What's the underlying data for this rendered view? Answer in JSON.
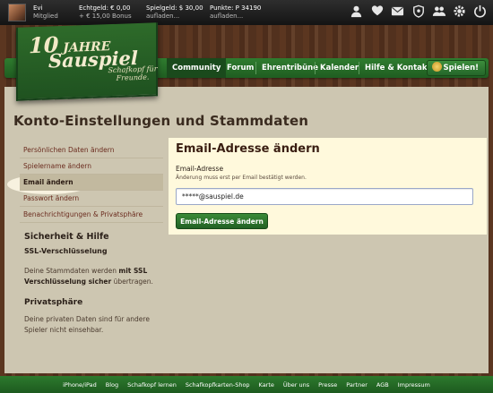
{
  "topbar": {
    "user_name": "Evi",
    "user_status": "Mitglied",
    "echtgeld": "Echtgeld: € 0,00",
    "bonus": "+ € 15,00 Bonus",
    "spielgeld": "Spielgeld: $ 30,00",
    "spielgeld_sub": "aufladen...",
    "punkte": "Punkte: P 34190",
    "punkte_sub": "aufladen...",
    "icons": [
      "profile-icon",
      "heart-icon",
      "mail-icon",
      "shield-icon",
      "friends-icon",
      "settings-icon",
      "logout-icon"
    ]
  },
  "logo": {
    "jahre_number": "10",
    "jahre_text": "JAHRE",
    "name": "Sauspiel",
    "tagline": "Schafkopf für Freunde."
  },
  "nav": {
    "items": [
      "Community",
      "Forum",
      "Ehrentribüne",
      "Kalender",
      "Hilfe & Kontakt"
    ],
    "active": "Community",
    "play_label": "Spielen!"
  },
  "page": {
    "title": "Konto-Einstellungen und Stammdaten"
  },
  "sidebar": {
    "items": [
      "Persönlichen Daten ändern",
      "Spielername ändern",
      "Email ändern",
      "Passwort ändern",
      "Benachrichtigungen & Privatsphäre"
    ],
    "active": "Email ändern",
    "security_heading": "Sicherheit & Hilfe",
    "ssl_heading": "SSL-Verschlüsselung",
    "ssl_text_1": "Deine Stammdaten werden ",
    "ssl_text_bold": "mit SSL Verschlüsselung sicher",
    "ssl_text_2": " übertragen.",
    "privacy_heading": "Privatsphäre",
    "privacy_text": "Deine privaten Daten sind für andere Spieler nicht einsehbar."
  },
  "form": {
    "title": "Email-Adresse ändern",
    "label": "Email-Adresse",
    "hint": "Änderung muss erst per Email bestätigt werden.",
    "email_value": "*****@sauspiel.de",
    "submit_label": "Email-Adresse ändern"
  },
  "footer": {
    "links": [
      "iPhone/iPad",
      "Blog",
      "Schafkopf lernen",
      "Schafkopfkarten-Shop",
      "Karte",
      "Über uns",
      "Presse",
      "Partner",
      "AGB",
      "Impressum"
    ]
  },
  "colors": {
    "green": "#2f7c2f",
    "content_bg": "#cdc6b1",
    "panel_bg": "#fff9dc",
    "link": "#6b2c1f"
  }
}
